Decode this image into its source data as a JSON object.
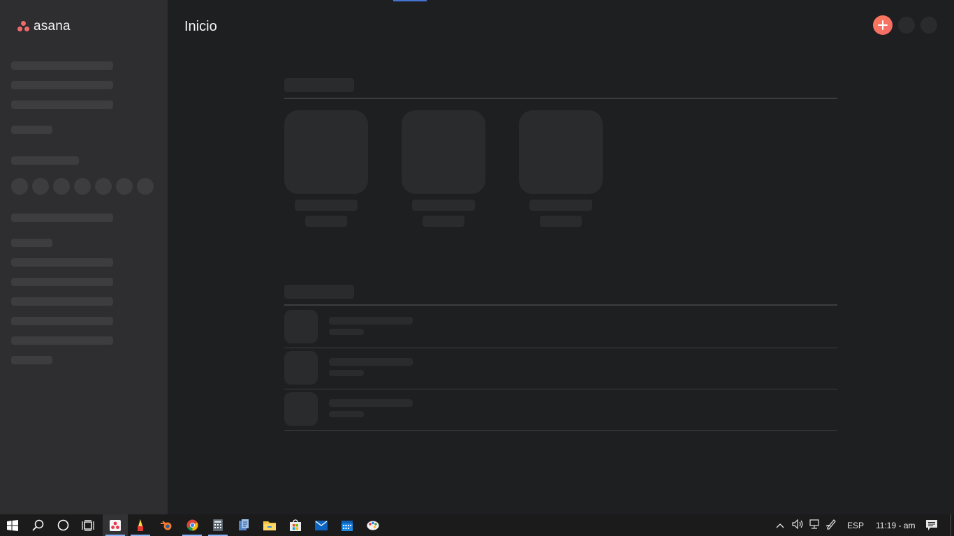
{
  "app": {
    "brand": "asana",
    "page_title": "Inicio",
    "accent_color": "#f06a6a",
    "add_icon": "plus-icon"
  },
  "taskbar": {
    "apps": [
      "windows-start-icon",
      "search-icon",
      "cortana-icon",
      "task-view-icon",
      "asana-app-icon",
      "paint-icon",
      "blender-icon",
      "chrome-icon",
      "calculator-icon",
      "file-manager-icon",
      "file-explorer-icon",
      "store-icon",
      "mail-icon",
      "calendar-icon",
      "paint3d-icon"
    ],
    "language": "ESP",
    "time": "11:19 - am"
  }
}
